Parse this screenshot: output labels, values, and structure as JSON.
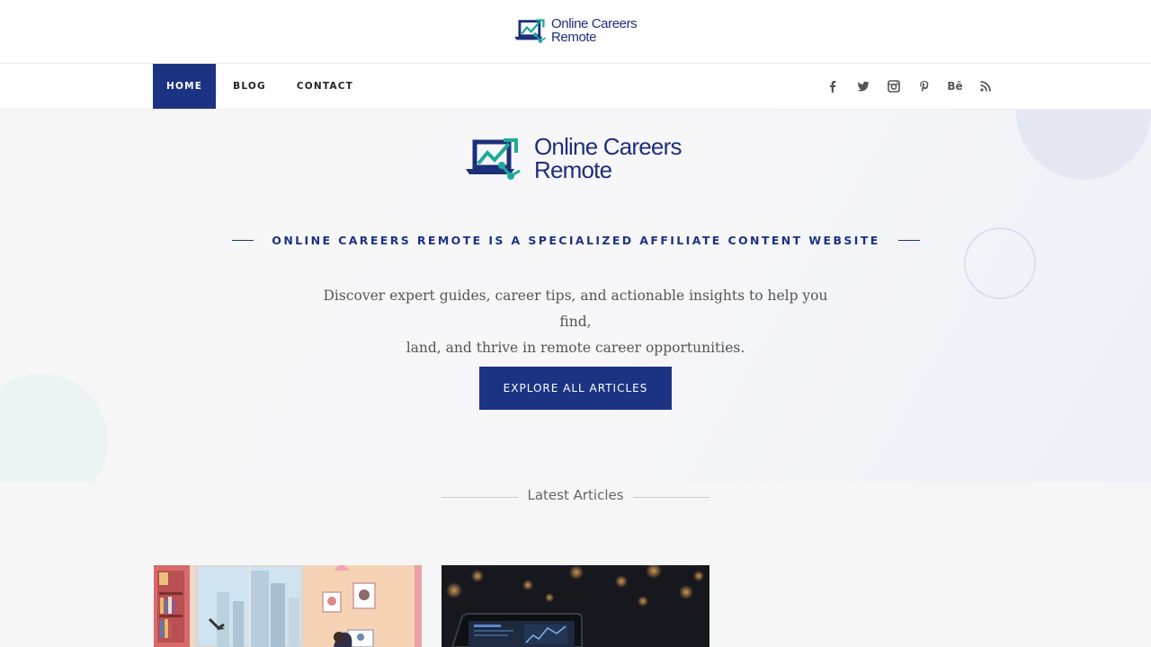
{
  "site": {
    "name_line1": "Online Careers",
    "name_line2": "Remote"
  },
  "nav": {
    "items": [
      {
        "label": "HOME",
        "active": true
      },
      {
        "label": "BLOG",
        "active": false
      },
      {
        "label": "CONTACT",
        "active": false
      }
    ],
    "social_icons": [
      "facebook-icon",
      "twitter-icon",
      "instagram-icon",
      "pinterest-icon",
      "behance-icon",
      "rss-icon"
    ],
    "behance_label": "Bē"
  },
  "hero": {
    "tagline": "ONLINE CAREERS REMOTE IS A SPECIALIZED AFFILIATE CONTENT WEBSITE",
    "description_line1": "Discover expert guides, career tips, and actionable insights to help you find,",
    "description_line2": "land, and thrive in remote career opportunities.",
    "cta_label": "EXPLORE ALL ARTICLES"
  },
  "latest": {
    "title": "Latest Articles",
    "cards": [
      {
        "image": "illustrated-home-office-image"
      },
      {
        "image": "laptop-dark-bokeh-image"
      }
    ]
  },
  "colors": {
    "brand_navy": "#1c3383",
    "brand_teal": "#1fa99a"
  }
}
